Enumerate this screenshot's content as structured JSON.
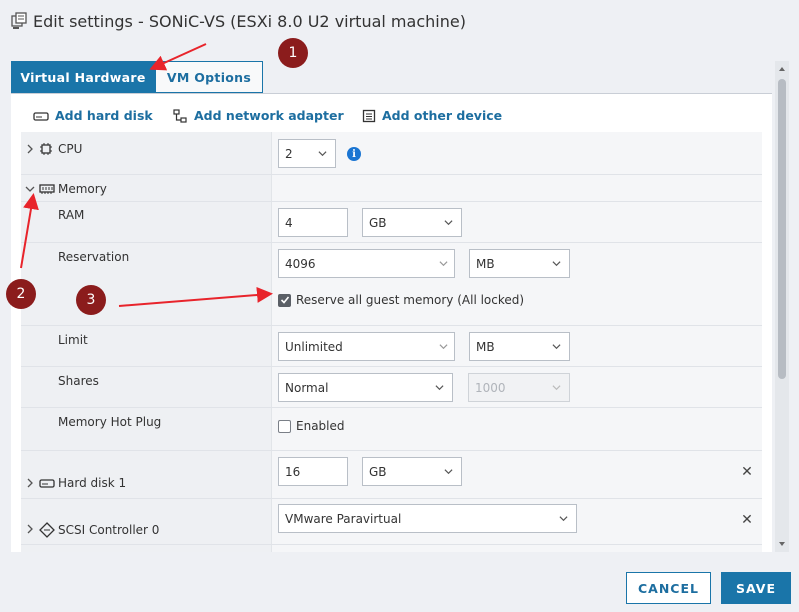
{
  "window": {
    "title": "Edit settings - SONiC-VS (ESXi 8.0 U2 virtual machine)"
  },
  "tabs": [
    {
      "label": "Virtual Hardware",
      "active": true
    },
    {
      "label": "VM Options",
      "active": false
    }
  ],
  "toolbar": {
    "add_hard_disk": "Add hard disk",
    "add_network_adapter": "Add network adapter",
    "add_other_device": "Add other device"
  },
  "cpu": {
    "label": "CPU",
    "value": "2"
  },
  "memory": {
    "label": "Memory",
    "ram": {
      "label": "RAM",
      "value": "4",
      "unit": "GB"
    },
    "reservation": {
      "label": "Reservation",
      "value": "4096",
      "unit": "MB",
      "reserve_all_label": "Reserve all guest memory (All locked)",
      "reserve_all_checked": true
    },
    "limit": {
      "label": "Limit",
      "value": "Unlimited",
      "unit": "MB"
    },
    "shares": {
      "label": "Shares",
      "value": "Normal",
      "amount": "1000"
    },
    "hot_plug": {
      "label": "Memory Hot Plug",
      "enabled_label": "Enabled",
      "checked": false
    }
  },
  "hard_disk": {
    "label": "Hard disk 1",
    "value": "16",
    "unit": "GB"
  },
  "scsi": {
    "label": "SCSI Controller 0",
    "value": "VMware Paravirtual"
  },
  "footer": {
    "cancel": "CANCEL",
    "save": "SAVE"
  },
  "annotations": [
    "1",
    "2",
    "3"
  ],
  "colors": {
    "accent": "#1a75a9",
    "annotation": "#8b1c1c",
    "arrow": "#e8242b"
  }
}
